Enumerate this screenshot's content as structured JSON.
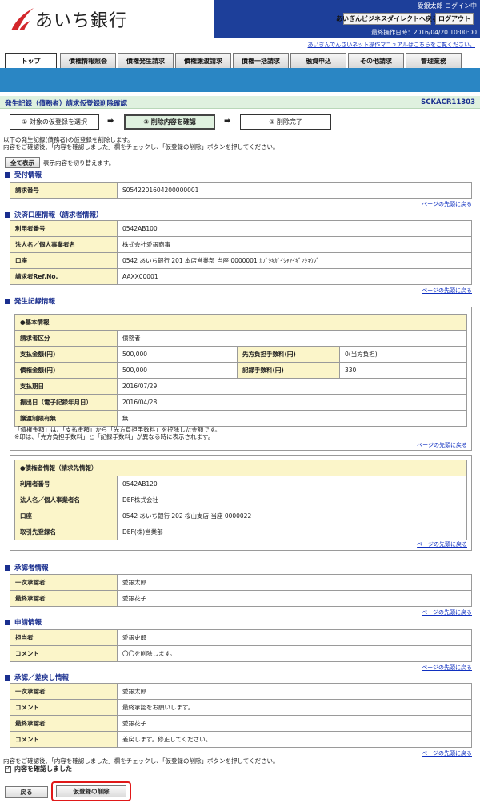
{
  "header": {
    "bank_name": "あいち銀行",
    "user_status": "愛銀太郎 ログイン中",
    "direct_button": "あいぎんビジネスダイレクトへ戻る",
    "logout_button": "ログアウト",
    "last_operation": "最終操作日時：2016/04/20 10:00:00",
    "manual_link": "あいぎんでんさいネット操作マニュアルはこちらをご覧ください。"
  },
  "nav": {
    "tabs": [
      "トップ",
      "債権情報照会",
      "債権発生請求",
      "債権譲渡請求",
      "債権一括請求",
      "融資申込",
      "その他請求",
      "管理業務"
    ]
  },
  "page": {
    "title": "発生記録（債務者）請求仮登録削除確認",
    "screen_id": "SCKACR11303",
    "steps": [
      "① 対象の仮登録を選択",
      "② 削除内容を確認",
      "③ 削除完了"
    ],
    "instruction_1": "以下の発生記録(債務者)の仮登録を削除します。",
    "instruction_2": "内容をご確認後、「内容を確認しました」欄をチェックし、「仮登録の削除」ボタンを押してください。",
    "show_all_button": "全て表示",
    "show_all_note": "表示内容を切り替えます。",
    "to_top": "ページの先頭に戻る"
  },
  "sections": {
    "reception": {
      "title": "受付情報",
      "rows": [
        [
          "請求番号",
          "S0542201604200000001"
        ]
      ]
    },
    "account": {
      "title": "決済口座情報（請求者情報）",
      "rows": [
        [
          "利用者番号",
          "0542AB100"
        ],
        [
          "法人名／個人事業者名",
          "株式会社愛銀商事"
        ],
        [
          "口座",
          "0542 あいち銀行 201 本店営業部 当座 0000001 ｶﾌﾞｼｷｶﾞｲｼｬｱｲｷﾞﾝｼｮｳｼﾞ"
        ],
        [
          "請求者Ref.No.",
          "AAXX00001"
        ]
      ]
    },
    "record": {
      "title": "発生記録情報",
      "basic_title": "●基本情報",
      "basic_rows": [
        [
          "請求者区分",
          "債務者"
        ],
        [
          "支払金額(円)",
          "500,000",
          "先方負担手数料(円)",
          "0(当方負担)"
        ],
        [
          "債権金額(円)",
          "500,000",
          "記録手数料(円)",
          "330"
        ],
        [
          "支払期日",
          "2016/07/29"
        ],
        [
          "振出日（電子記録年月日）",
          "2016/04/28"
        ],
        [
          "譲渡制限有無",
          "無"
        ]
      ],
      "basic_note_1": "「債権金額」は、「支払金額」から「先方負担手数料」を控除した金額です。",
      "basic_note_2": "※印は、「先方負担手数料」と「記録手数料」が異なる時に表示されます。",
      "creditor_title": "●債権者情報（請求先情報）",
      "creditor_rows": [
        [
          "利用者番号",
          "0542AB120"
        ],
        [
          "法人名／個人事業者名",
          "DEF株式会社"
        ],
        [
          "口座",
          "0542 あいち銀行 202 桜山支店 当座 0000022"
        ],
        [
          "取引先登録名",
          "DEF(株)営業部"
        ]
      ]
    },
    "approver": {
      "title": "承認者情報",
      "rows": [
        [
          "一次承認者",
          "愛銀太郎"
        ],
        [
          "最終承認者",
          "愛銀花子"
        ]
      ]
    },
    "application": {
      "title": "申請情報",
      "rows": [
        [
          "担当者",
          "愛銀史郎"
        ],
        [
          "コメント",
          "〇〇を削除します。"
        ]
      ]
    },
    "approval": {
      "title": "承認／差戻し情報",
      "rows": [
        [
          "一次承認者",
          "愛銀太郎"
        ],
        [
          "コメント",
          "最終承認をお願いします。"
        ],
        [
          "最終承認者",
          "愛銀花子"
        ],
        [
          "コメント",
          "差戻します。修正してください。"
        ]
      ]
    }
  },
  "footer": {
    "instruction": "内容をご確認後、「内容を確認しました」欄をチェックし、「仮登録の削除」ボタンを押してください。",
    "confirm_label": "内容を確認しました",
    "back_button": "戻る",
    "delete_button": "仮登録の削除"
  },
  "colors": {
    "header_blue": "#1d3f9a",
    "band_blue": "#2a86c4",
    "title_green": "#dff1df",
    "label_yellow": "#fbf5c9",
    "highlight_red": "#e01818",
    "logo_red": "#d3272b"
  }
}
